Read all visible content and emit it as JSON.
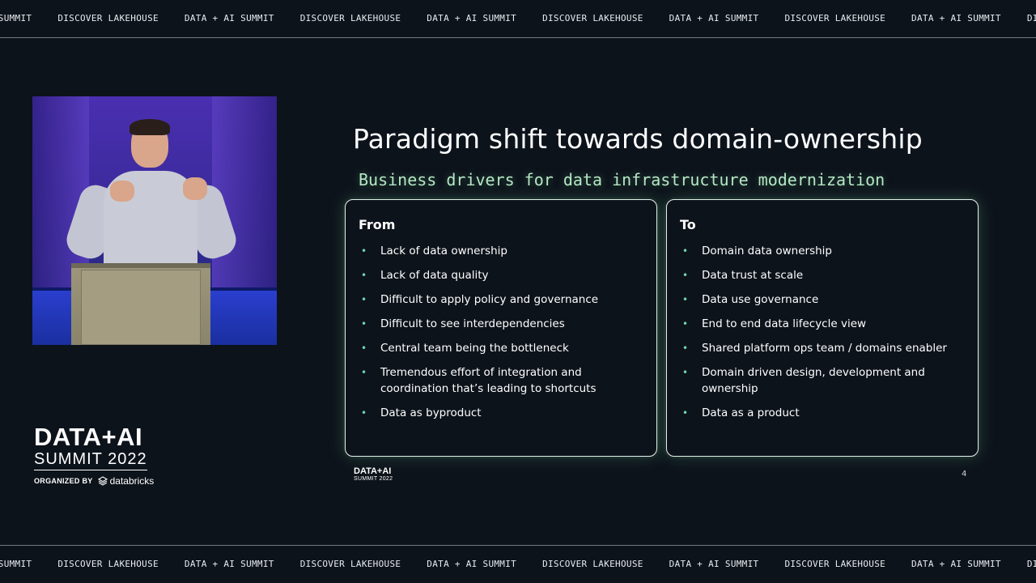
{
  "ticker": {
    "items": [
      "AI SUMMIT",
      "DISCOVER LAKEHOUSE",
      "DATA + AI SUMMIT",
      "DISCOVER LAKEHOUSE",
      "DATA + AI SUMMIT",
      "DISCOVER LAKEHOUSE",
      "DATA + AI SUMMIT",
      "DISCOVER LAKEHOUSE",
      "DATA + AI SUMMIT",
      "DISCOVER LA"
    ]
  },
  "event_logo": {
    "line1": "DATA+AI",
    "line2": "SUMMIT 2022",
    "organized_by": "ORGANIZED BY",
    "brand": "databricks"
  },
  "slide": {
    "title": "Paradigm shift towards domain-ownership",
    "subtitle": "Business drivers for data infrastructure modernization",
    "from": {
      "title": "From",
      "items": [
        "Lack of data ownership",
        "Lack of data quality",
        "Difficult to apply policy and governance",
        "Difficult to see interdependencies",
        "Central team being the bottleneck",
        "Tremendous effort of integration and coordination that’s leading to shortcuts",
        "Data as byproduct"
      ]
    },
    "to": {
      "title": "To",
      "items": [
        "Domain data ownership",
        "Data trust at scale",
        "Data use governance",
        "End to end data lifecycle view",
        "Shared platform ops team / domains enabler",
        "Domain driven design, development and ownership",
        "Data as a product"
      ]
    },
    "footer_logo": {
      "line1": "DATA+AI",
      "line2": "SUMMIT 2022"
    },
    "page_number": "4"
  },
  "colors": {
    "background": "#0d131b",
    "accent_green": "#b4e8c4",
    "bullet": "#6fd6b0"
  }
}
